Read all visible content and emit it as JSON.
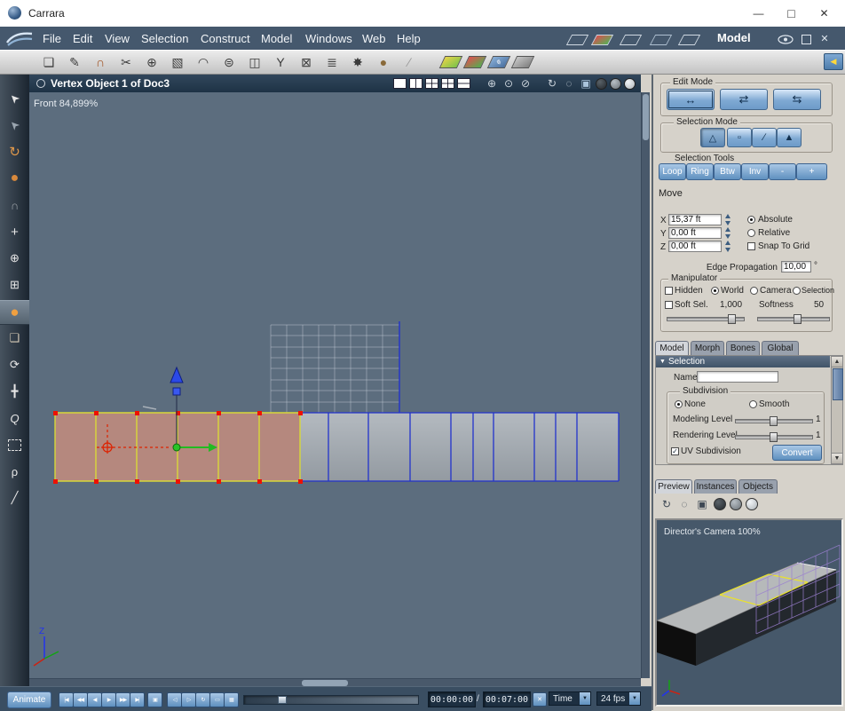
{
  "window": {
    "title": "Carrara"
  },
  "menubar": {
    "items": [
      "File",
      "Edit",
      "View",
      "Selection",
      "Construct",
      "Model",
      "Windows",
      "Web",
      "Help"
    ],
    "mode_label": "Model"
  },
  "viewport": {
    "title": "Vertex Object 1 of Doc3",
    "view_info": "Front 84,899%"
  },
  "axis": {
    "z": "Z"
  },
  "panel": {
    "edit_mode_label": "Edit Mode",
    "selection_mode_label": "Selection Mode",
    "selection_tools_label": "Selection Tools",
    "selection_tools": [
      "Loop",
      "Ring",
      "Btw",
      "Inv",
      "-",
      "+"
    ],
    "move_label": "Move",
    "axes": {
      "x_label": "X",
      "x_value": "15,37 ft",
      "y_label": "Y",
      "y_value": "0,00 ft",
      "z_label": "Z",
      "z_value": "0,00 ft"
    },
    "absolute_label": "Absolute",
    "relative_label": "Relative",
    "snap_label": "Snap To Grid",
    "edge_prop_label": "Edge Propagation",
    "edge_prop_value": "10,00",
    "edge_prop_unit": "°",
    "manipulator_label": "Manipulator",
    "hidden_label": "Hidden",
    "world_label": "World",
    "camera_label": "Camera",
    "selection_label": "Selection",
    "soft_sel_label": "Soft Sel.",
    "soft_sel_value": "1,000",
    "softness_label": "Softness",
    "softness_value": "50",
    "tabs": [
      "Model",
      "Morph",
      "Bones",
      "Global"
    ],
    "selection_header": "Selection",
    "name_label": "Name",
    "name_value": "",
    "subdivision_label": "Subdivision",
    "none_label": "None",
    "smooth_label": "Smooth",
    "modeling_label": "Modeling Level",
    "modeling_value": "1",
    "rendering_label": "Rendering Level",
    "rendering_value": "1",
    "uv_label": "UV Subdivision",
    "convert_label": "Convert",
    "preview_tabs": [
      "Preview",
      "Instances",
      "Objects"
    ],
    "camera_name": "Director's Camera 100%"
  },
  "bottom": {
    "animate": "Animate",
    "vcr": [
      "|◀",
      "◀◀",
      "◀",
      "▶",
      "▶▶",
      "▶|"
    ],
    "vcr_range": "▣",
    "vcr2": [
      "◁",
      "▷",
      "↻",
      "▭",
      "▦"
    ],
    "time_current": "00:00:00",
    "time_separator": "/",
    "time_end": "00:07:00",
    "time_mode": "Time",
    "fps": "24 fps"
  },
  "icons": {
    "titlebar": {
      "minimize": "—",
      "maximize": "□",
      "close": "✕"
    },
    "menubar_close": "✕",
    "collapse": "◀",
    "check": "✓",
    "selection_arrow": "▼",
    "dropdown": "▼",
    "scroll_up": "▲",
    "scroll_down": "▼",
    "toolbar": [
      "❏",
      "✎",
      "∩",
      "✂",
      "⊕",
      "▧",
      "◠",
      "⊜",
      "◫",
      "Y",
      "⊠",
      "≣",
      "✸",
      "●",
      "∕"
    ],
    "left": {
      "select": "➤",
      "direct_select": "➤",
      "rotate": "↻",
      "sphere": "●",
      "magnet": "∩",
      "move": "+",
      "move_axis": "⊕",
      "move_plane": "⊞",
      "sphere_sel": "●",
      "cube": "❏",
      "orbit": "⟳",
      "pan": "╋",
      "zoom": "Q",
      "lasso": "ρ",
      "knife": "╱"
    },
    "edit_mode": [
      "↔",
      "⇄",
      "⇆"
    ],
    "selection_mode": [
      "△",
      "▫",
      "∕",
      "▲"
    ],
    "header_spheres": [
      "⊕",
      "⊙",
      "⊘"
    ],
    "display": {
      "orbit": "↻",
      "dashed": "◌",
      "wirecube": "▣"
    }
  },
  "colors": {
    "accent_blue": "#5f90bf",
    "selected_face": "#b5887e",
    "selected_edge": "#d8d838",
    "vertex_red": "#ee1100",
    "wire_blue": "#2233cc",
    "viewport_bg": "#5c6d7e"
  }
}
